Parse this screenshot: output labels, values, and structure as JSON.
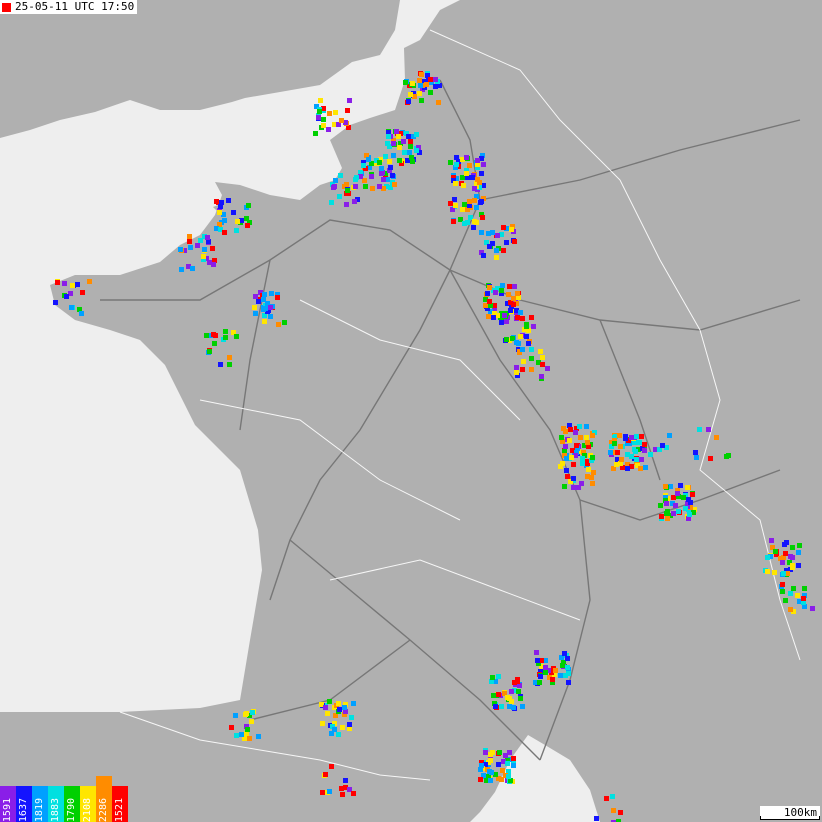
{
  "header": {
    "timestamp": "25-05-11 UTC 17:50"
  },
  "legend": {
    "items": [
      {
        "label": "1591",
        "color": "#8a1ee8"
      },
      {
        "label": "1637",
        "color": "#1414ff"
      },
      {
        "label": "1819",
        "color": "#00a0ff"
      },
      {
        "label": "1883",
        "color": "#00e0e0"
      },
      {
        "label": "1790",
        "color": "#00d000"
      },
      {
        "label": "2108",
        "color": "#ffe600"
      },
      {
        "label": "2286",
        "color": "#ff8c00"
      },
      {
        "label": "1521",
        "color": "#ff0000"
      }
    ]
  },
  "scale": {
    "label": "100km"
  },
  "colors": {
    "sea": "#eeeeee",
    "land": "#b0b0b0",
    "roads": "#777777",
    "borders": "#ffffff",
    "marker": "#ff0000"
  }
}
